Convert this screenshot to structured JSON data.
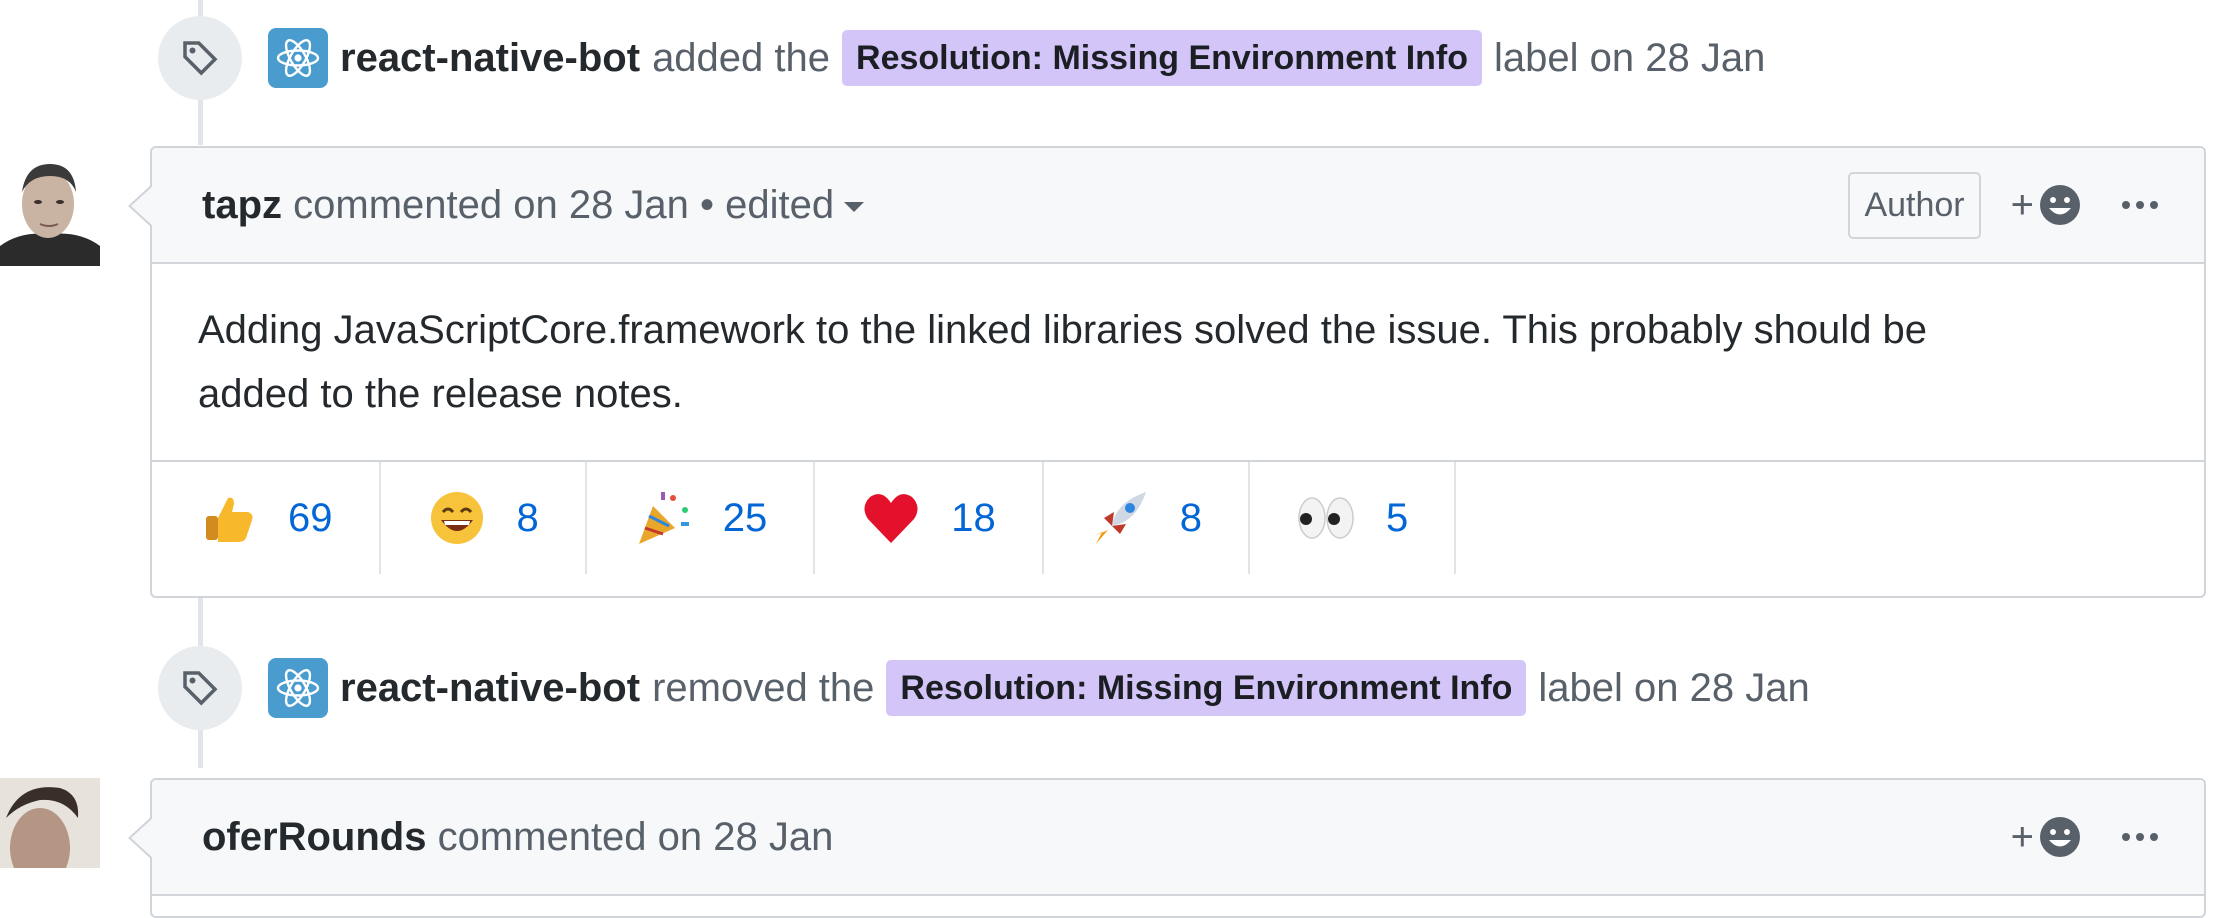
{
  "events": [
    {
      "actor": "react-native-bot",
      "action": "added the",
      "label": "Resolution: Missing Environment Info",
      "suffix": "label on 28 Jan"
    },
    {
      "actor": "react-native-bot",
      "action": "removed the",
      "label": "Resolution: Missing Environment Info",
      "suffix": "label on 28 Jan"
    }
  ],
  "comments": [
    {
      "author": "tapz",
      "meta": "commented on 28 Jan • edited",
      "badge": "Author",
      "body_line1": "Adding JavaScriptCore.framework to the linked libraries solved the issue. This probably should be",
      "body_line2": "added to the release notes.",
      "reactions": [
        {
          "icon": "thumbs-up-icon",
          "count": "69"
        },
        {
          "icon": "laugh-icon",
          "count": "8"
        },
        {
          "icon": "hooray-icon",
          "count": "25"
        },
        {
          "icon": "heart-icon",
          "count": "18"
        },
        {
          "icon": "rocket-icon",
          "count": "8"
        },
        {
          "icon": "eyes-icon",
          "count": "5"
        }
      ]
    },
    {
      "author": "oferRounds",
      "meta": "commented on 28 Jan"
    }
  ],
  "reaction_add_label": "+",
  "colors": {
    "label_bg": "#d4c5f9",
    "link_blue": "#0366d6",
    "header_bg": "#f6f8fa",
    "border": "#d1d5da"
  }
}
